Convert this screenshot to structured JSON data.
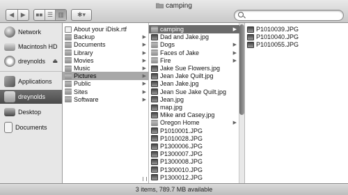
{
  "window": {
    "title": "camping"
  },
  "toolbar": {
    "back_label": "◀",
    "forward_label": "▶",
    "view_icons": "◼◼",
    "view_list": "☰",
    "view_columns": "▥",
    "action_label": "✱▾",
    "search_placeholder": ""
  },
  "sidebar": {
    "items": [
      {
        "label": "Network",
        "icon": "globe-icon"
      },
      {
        "label": "Macintosh HD",
        "icon": "harddisk-icon"
      },
      {
        "label": "dreynolds",
        "icon": "idisk-icon"
      },
      {
        "label": "Applications",
        "icon": "applications-icon"
      },
      {
        "label": "dreynolds",
        "icon": "home-icon",
        "selected": true
      },
      {
        "label": "Desktop",
        "icon": "desktop-icon"
      },
      {
        "label": "Documents",
        "icon": "documents-icon"
      }
    ],
    "eject_label": "⏏"
  },
  "columns": [
    {
      "items": [
        {
          "label": "About your iDisk.rtf",
          "type": "doc"
        },
        {
          "label": "Backup",
          "type": "folder",
          "arrow": true
        },
        {
          "label": "Documents",
          "type": "folder",
          "arrow": true
        },
        {
          "label": "Library",
          "type": "folder",
          "arrow": true
        },
        {
          "label": "Movies",
          "type": "folder",
          "arrow": true
        },
        {
          "label": "Music",
          "type": "folder",
          "arrow": true
        },
        {
          "label": "Pictures",
          "type": "folder",
          "arrow": true,
          "selected": "light"
        },
        {
          "label": "Public",
          "type": "folder",
          "arrow": true
        },
        {
          "label": "Sites",
          "type": "folder",
          "arrow": true
        },
        {
          "label": "Software",
          "type": "folder",
          "arrow": true
        }
      ]
    },
    {
      "items": [
        {
          "label": "camping",
          "type": "folder",
          "arrow": true,
          "selected": "dark"
        },
        {
          "label": "Dad and Jake.jpg",
          "type": "image"
        },
        {
          "label": "Dogs",
          "type": "folder",
          "arrow": true
        },
        {
          "label": "Faces of Jake",
          "type": "folder",
          "arrow": true
        },
        {
          "label": "Fire",
          "type": "folder",
          "arrow": true
        },
        {
          "label": "Jake Sue Flowers.jpg",
          "type": "image"
        },
        {
          "label": "Jean Jake Quilt.jpg",
          "type": "image"
        },
        {
          "label": "Jean Jake.jpg",
          "type": "image"
        },
        {
          "label": "Jean Sue Jake Quilt.jpg",
          "type": "image"
        },
        {
          "label": "Jean.jpg",
          "type": "image"
        },
        {
          "label": "map.jpg",
          "type": "image"
        },
        {
          "label": "Mike and Casey.jpg",
          "type": "image"
        },
        {
          "label": "Oregon Home",
          "type": "folder",
          "arrow": true
        },
        {
          "label": "P1010001.JPG",
          "type": "image"
        },
        {
          "label": "P1010028.JPG",
          "type": "image"
        },
        {
          "label": "P1300006.JPG",
          "type": "image"
        },
        {
          "label": "P1300007.JPG",
          "type": "image"
        },
        {
          "label": "P1300008.JPG",
          "type": "image"
        },
        {
          "label": "P1300010.JPG",
          "type": "image"
        },
        {
          "label": "P1300012.JPG",
          "type": "image"
        }
      ]
    },
    {
      "items": [
        {
          "label": "P1010039.JPG",
          "type": "image"
        },
        {
          "label": "P1010040.JPG",
          "type": "image"
        },
        {
          "label": "P1010055.JPG",
          "type": "image"
        }
      ]
    }
  ],
  "status": {
    "text": "3 items, 789.7 MB available"
  }
}
